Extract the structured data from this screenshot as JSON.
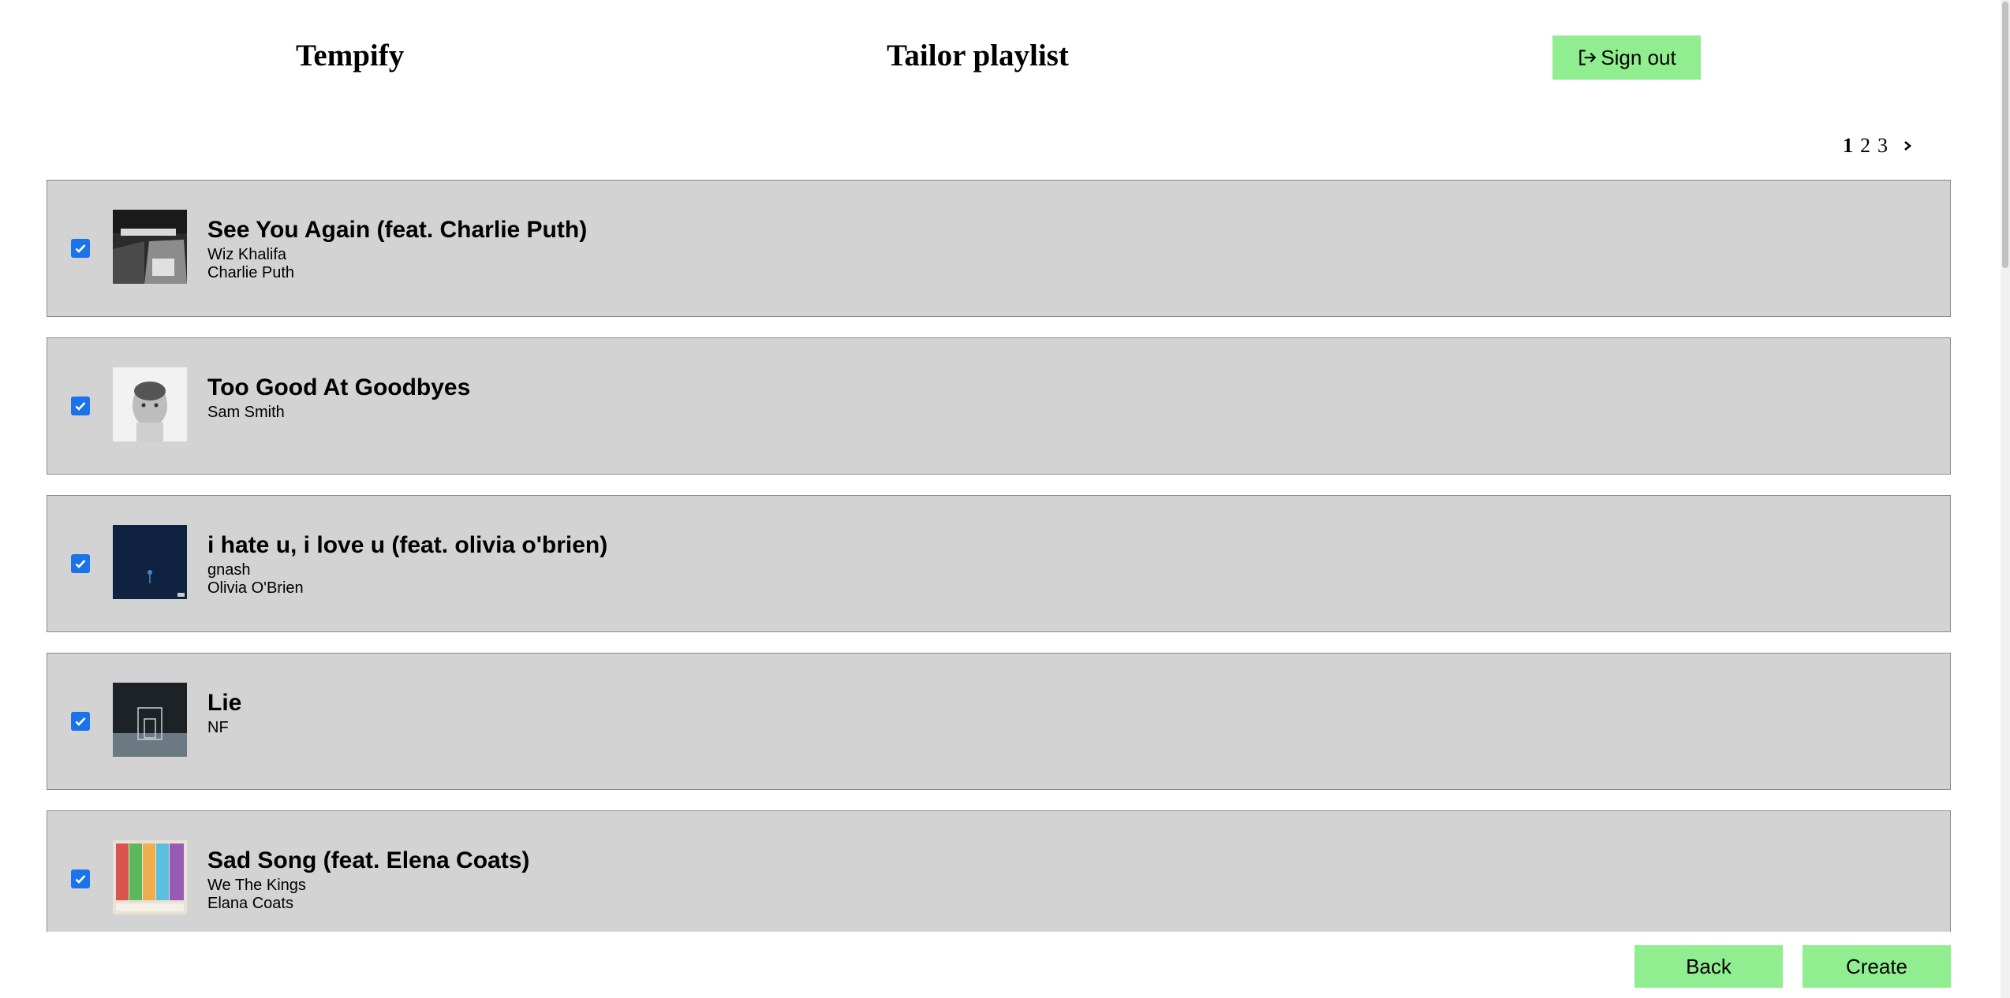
{
  "header": {
    "brand": "Tempify",
    "title": "Tailor playlist",
    "sign_out_label": "Sign out"
  },
  "pagination": {
    "pages": [
      "1",
      "2",
      "3"
    ],
    "current": "1"
  },
  "tracks": [
    {
      "title": "See You Again (feat. Charlie Puth)",
      "artists": [
        "Wiz Khalifa",
        "Charlie Puth"
      ],
      "checked": true
    },
    {
      "title": "Too Good At Goodbyes",
      "artists": [
        "Sam Smith"
      ],
      "checked": true
    },
    {
      "title": "i hate u, i love u (feat. olivia o'brien)",
      "artists": [
        "gnash",
        "Olivia O'Brien"
      ],
      "checked": true
    },
    {
      "title": "Lie",
      "artists": [
        "NF"
      ],
      "checked": true
    },
    {
      "title": "Sad Song (feat. Elena Coats)",
      "artists": [
        "We The Kings",
        "Elana Coats"
      ],
      "checked": true
    }
  ],
  "footer": {
    "back_label": "Back",
    "create_label": "Create"
  },
  "colors": {
    "button_bg": "#90ee90",
    "row_bg": "#d3d3d3",
    "checkbox": "#1a73e8"
  },
  "icons": {
    "sign_out": "sign-out-icon",
    "next_page": "chevron-right-icon",
    "checkbox": "checkbox-checked-icon"
  }
}
